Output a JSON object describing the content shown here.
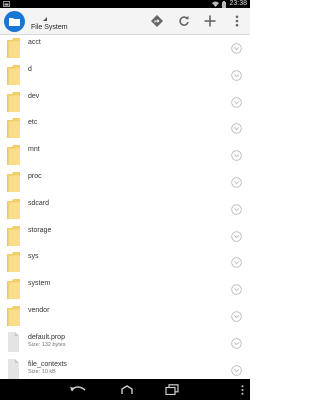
{
  "status_bar": {
    "time": "23:38",
    "icons": [
      "notification-icon",
      "wifi-icon",
      "battery-icon"
    ]
  },
  "action_bar": {
    "app_icon": "folder-icon",
    "title": "File System",
    "actions": [
      "bookmark-icon",
      "refresh-icon",
      "add-icon",
      "overflow-menu-icon"
    ]
  },
  "files": [
    {
      "name": "acct",
      "type": "folder"
    },
    {
      "name": "d",
      "type": "folder"
    },
    {
      "name": "dev",
      "type": "folder"
    },
    {
      "name": "etc",
      "type": "folder"
    },
    {
      "name": "mnt",
      "type": "folder"
    },
    {
      "name": "proc",
      "type": "folder"
    },
    {
      "name": "sdcard",
      "type": "folder"
    },
    {
      "name": "storage",
      "type": "folder"
    },
    {
      "name": "sys",
      "type": "folder"
    },
    {
      "name": "system",
      "type": "folder"
    },
    {
      "name": "vendor",
      "type": "folder"
    },
    {
      "name": "default.prop",
      "type": "file",
      "size": "Size: 132 bytes"
    },
    {
      "name": "file_contexts",
      "type": "file",
      "size": "Size: 10 kB"
    }
  ],
  "nav_bar": {
    "buttons": [
      "back-icon",
      "home-icon",
      "recents-icon",
      "menu-icon"
    ]
  },
  "colors": {
    "accent": "#1976d2",
    "folder": "#f6d77a"
  }
}
